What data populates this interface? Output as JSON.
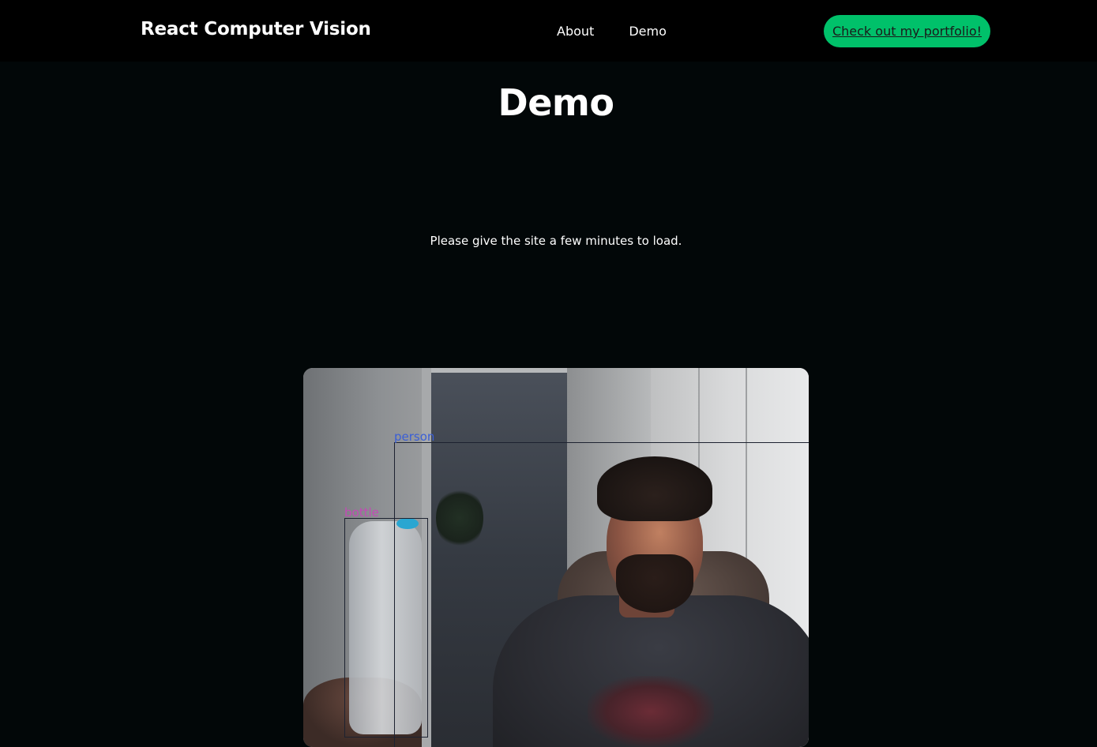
{
  "navbar": {
    "brand": "React Computer Vision",
    "links": [
      {
        "label": "About"
      },
      {
        "label": "Demo"
      }
    ],
    "cta_label": "Check out my portfolio!"
  },
  "main": {
    "title": "Demo",
    "load_note": "Please give the site a few minutes to load."
  },
  "webcam": {
    "detections": [
      {
        "label": "person",
        "color": "#3b5fd6"
      },
      {
        "label": "bottle",
        "color": "#c24bb5"
      }
    ]
  },
  "colors": {
    "background": "#020708",
    "navbar": "#000000",
    "accent": "#00c16a"
  }
}
